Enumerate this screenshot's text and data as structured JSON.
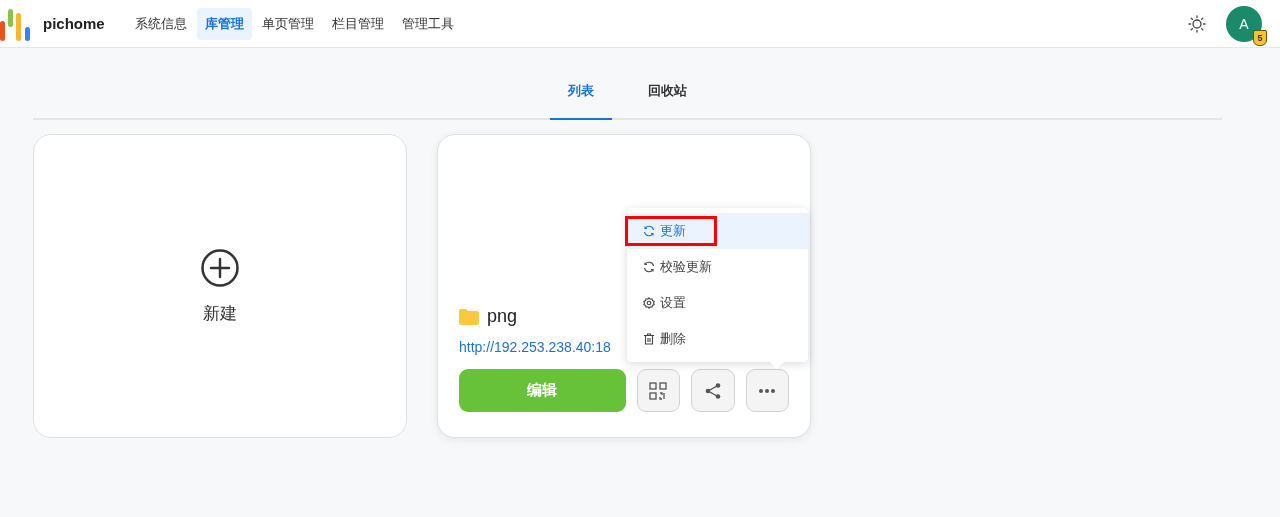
{
  "header": {
    "logo_text": "pichome",
    "nav": [
      {
        "label": "系统信息",
        "selected": false
      },
      {
        "label": "库管理",
        "selected": true
      },
      {
        "label": "单页管理",
        "selected": false
      },
      {
        "label": "栏目管理",
        "selected": false
      },
      {
        "label": "管理工具",
        "selected": false
      }
    ],
    "avatar": {
      "initial": "A",
      "badge": "5"
    }
  },
  "tabs": [
    {
      "label": "列表",
      "selected": true
    },
    {
      "label": "回收站",
      "selected": false
    }
  ],
  "new_card": {
    "label": "新建"
  },
  "library_card": {
    "name": "png",
    "url": "http://192.253.238.40:18",
    "edit_button": "编辑"
  },
  "menu": [
    {
      "kind": "refresh",
      "label": "更新",
      "selected": true,
      "annotated": true
    },
    {
      "kind": "refresh",
      "label": "校验更新",
      "selected": false,
      "annotated": false
    },
    {
      "kind": "settings",
      "label": "设置",
      "selected": false,
      "annotated": false
    },
    {
      "kind": "delete",
      "label": "删除",
      "selected": false,
      "annotated": false
    }
  ]
}
